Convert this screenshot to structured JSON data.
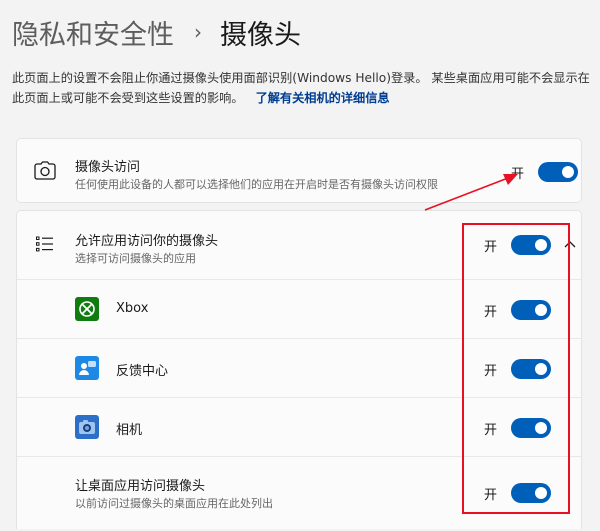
{
  "header": {
    "parent": "隐私和安全性",
    "separator": "›",
    "current": "摄像头"
  },
  "intro": {
    "text": "此页面上的设置不会阻止你通过摄像头使用面部识别(Windows Hello)登录。 某些桌面应用可能不会显示在此页面上或可能不会受到这些设置的影响。",
    "link": "了解有关相机的详细信息"
  },
  "camera_access": {
    "title": "摄像头访问",
    "subtitle": "任何使用此设备的人都可以选择他们的应用在开启时是否有摄像头访问权限",
    "state": "开",
    "on": true,
    "icon": "camera-icon"
  },
  "allow_apps": {
    "title": "允许应用访问你的摄像头",
    "subtitle": "选择可访问摄像头的应用",
    "state": "开",
    "on": true,
    "icon": "list-icon",
    "expand_icon": "chevron-up-icon"
  },
  "apps": [
    {
      "name": "Xbox",
      "state": "开",
      "on": true,
      "icon": "xbox-icon"
    },
    {
      "name": "反馈中心",
      "state": "开",
      "on": true,
      "icon": "feedback-hub-icon"
    },
    {
      "name": "相机",
      "state": "开",
      "on": true,
      "icon": "camera-app-icon"
    }
  ],
  "desktop_apps": {
    "title": "让桌面应用访问摄像头",
    "subtitle": "以前访问过摄像头的桌面应用在此处列出",
    "state": "开",
    "on": true
  },
  "colors": {
    "accent": "#005fb8",
    "annotation": "#e81123",
    "link": "#003e92"
  }
}
